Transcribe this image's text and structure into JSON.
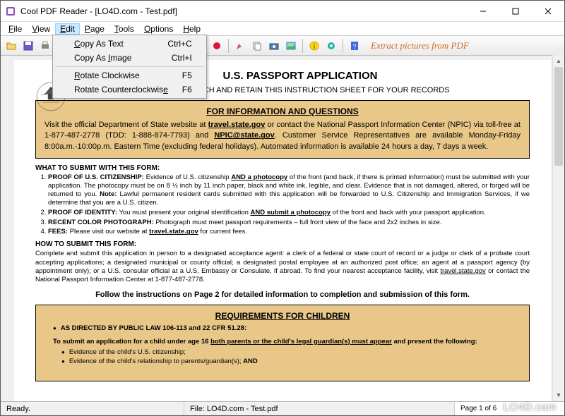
{
  "title": "Cool PDF Reader - [LO4D.com - Test.pdf]",
  "menubar": {
    "file": "File",
    "view": "View",
    "edit": "Edit",
    "page": "Page",
    "tools": "Tools",
    "options": "Options",
    "help": "Help"
  },
  "editmenu": {
    "copy_text": "Copy As Text",
    "copy_text_key": "Ctrl+C",
    "copy_image": "Copy As Image",
    "copy_image_key": "Ctrl+I",
    "rotate_cw": "Rotate Clockwise",
    "rotate_cw_key": "F5",
    "rotate_ccw": "Rotate Counterclockwise",
    "rotate_ccw_key": "F6"
  },
  "toolbar_hint": "Extract pictures from PDF",
  "statusbar": {
    "ready": "Ready.",
    "file": "File: LO4D.com - Test.pdf",
    "page": "Page 1 of 6"
  },
  "watermark": "LO4D.com",
  "doc": {
    "title": "U.S. PASSPORT APPLICATION",
    "subtitle": "PLEASE DETACH AND RETAIN THIS INSTRUCTION SHEET FOR YOUR RECORDS",
    "box1_title": "FOR INFORMATION AND QUESTIONS",
    "box1_body_a": "Visit the official Department of State website at ",
    "box1_link1": "travel.state.gov",
    "box1_body_b": " or contact the National Passport Information Center (NPIC) via toll-free at 1-877-487-2778 (TDD: 1-888-874-7793) and ",
    "box1_link2": "NPIC@state.gov",
    "box1_body_c": ".  Customer Service Representatives are available Monday-Friday 8:00a.m.-10:00p.m. Eastern Time (excluding federal holidays). Automated information is available 24 hours a day, 7 days a week.",
    "what_head": "WHAT TO SUBMIT WITH THIS FORM:",
    "what1_a": "PROOF OF U.S. CITIZENSHIP:",
    "what1_b": " Evidence of U.S. citizenship ",
    "what1_c": "AND a photocopy",
    "what1_d": " of the front (and back, if there is printed information) must be submitted with your application. The photocopy must be on 8 ½ inch by 11 inch paper, black and white ink, legible, and clear. Evidence that is not damaged, altered, or forged will be returned to you. ",
    "what1_e": "Note:",
    "what1_f": " Lawful permanent resident cards submitted with this application will be forwarded to U.S. Citizenship and Immigration Services, if we determine that you are a U.S. citizen.",
    "what2_a": "PROOF OF IDENTITY:",
    "what2_b": " You must present your original identification ",
    "what2_c": "AND submit a photocopy",
    "what2_d": " of the front and back with your passport application.",
    "what3_a": "RECENT COLOR PHOTOGRAPH:",
    "what3_b": " Photograph must meet passport requirements – full front view of the face and 2x2 inches in size.",
    "what4_a": "FEES:",
    "what4_b": " Please visit our website at ",
    "what4_c": "travel.state.gov",
    "what4_d": " for current fees.",
    "how_head": "HOW TO SUBMIT THIS FORM:",
    "how_body_a": "Complete and submit this application in person to a designated acceptance agent:  a clerk of a federal or state court of record or a judge or clerk of a probate court accepting applications; a designated municipal or county official; a designated postal employee at an authorized post office; an agent at a passport agency (by appointment only); or a U.S. consular official at a U.S. Embassy or Consulate, if abroad.  To find your nearest acceptance facility, visit ",
    "how_link": "travel.state.gov",
    "how_body_b": " or contact the National Passport Information Center at 1-877-487-2778.",
    "center_instr": "Follow the instructions on Page 2 for detailed information to completion and submission of this form.",
    "box2_title": "REQUIREMENTS FOR CHILDREN",
    "box2_bullet1": "AS DIRECTED BY PUBLIC LAW 106-113 and 22 CFR 51.28:",
    "box2_sub_a": "To submit an application for a child under age 16 ",
    "box2_sub_b": "both parents or the child's legal guardian(s) must appear",
    "box2_sub_c": " and present the following:",
    "box2_ev1": "Evidence of the child's U.S. citizenship;",
    "box2_ev2_a": "Evidence of the child's relationship to parents/guardian(s); ",
    "box2_ev2_b": "AND"
  }
}
